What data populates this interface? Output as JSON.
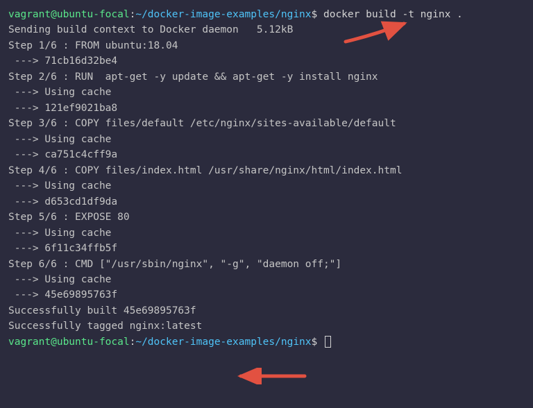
{
  "prompt1": {
    "user": "vagrant",
    "at": "@",
    "host": "ubuntu-focal",
    "colon": ":",
    "path": "~/docker-image-examples/nginx",
    "dollar": "$ ",
    "command": "docker build -t nginx ."
  },
  "output": [
    "Sending build context to Docker daemon   5.12kB",
    "Step 1/6 : FROM ubuntu:18.04",
    " ---> 71cb16d32be4",
    "Step 2/6 : RUN  apt-get -y update && apt-get -y install nginx",
    " ---> Using cache",
    " ---> 121ef9021ba8",
    "Step 3/6 : COPY files/default /etc/nginx/sites-available/default",
    " ---> Using cache",
    " ---> ca751c4cff9a",
    "Step 4/6 : COPY files/index.html /usr/share/nginx/html/index.html",
    " ---> Using cache",
    " ---> d653cd1df9da",
    "Step 5/6 : EXPOSE 80",
    " ---> Using cache",
    " ---> 6f11c34ffb5f",
    "Step 6/6 : CMD [\"/usr/sbin/nginx\", \"-g\", \"daemon off;\"]",
    " ---> Using cache",
    " ---> 45e69895763f",
    "Successfully built 45e69895763f",
    "Successfully tagged nginx:latest"
  ],
  "prompt2": {
    "user": "vagrant",
    "at": "@",
    "host": "ubuntu-focal",
    "colon": ":",
    "path": "~/docker-image-examples/nginx",
    "dollar": "$ "
  },
  "annotations": {
    "arrow_color": "#e25141"
  }
}
